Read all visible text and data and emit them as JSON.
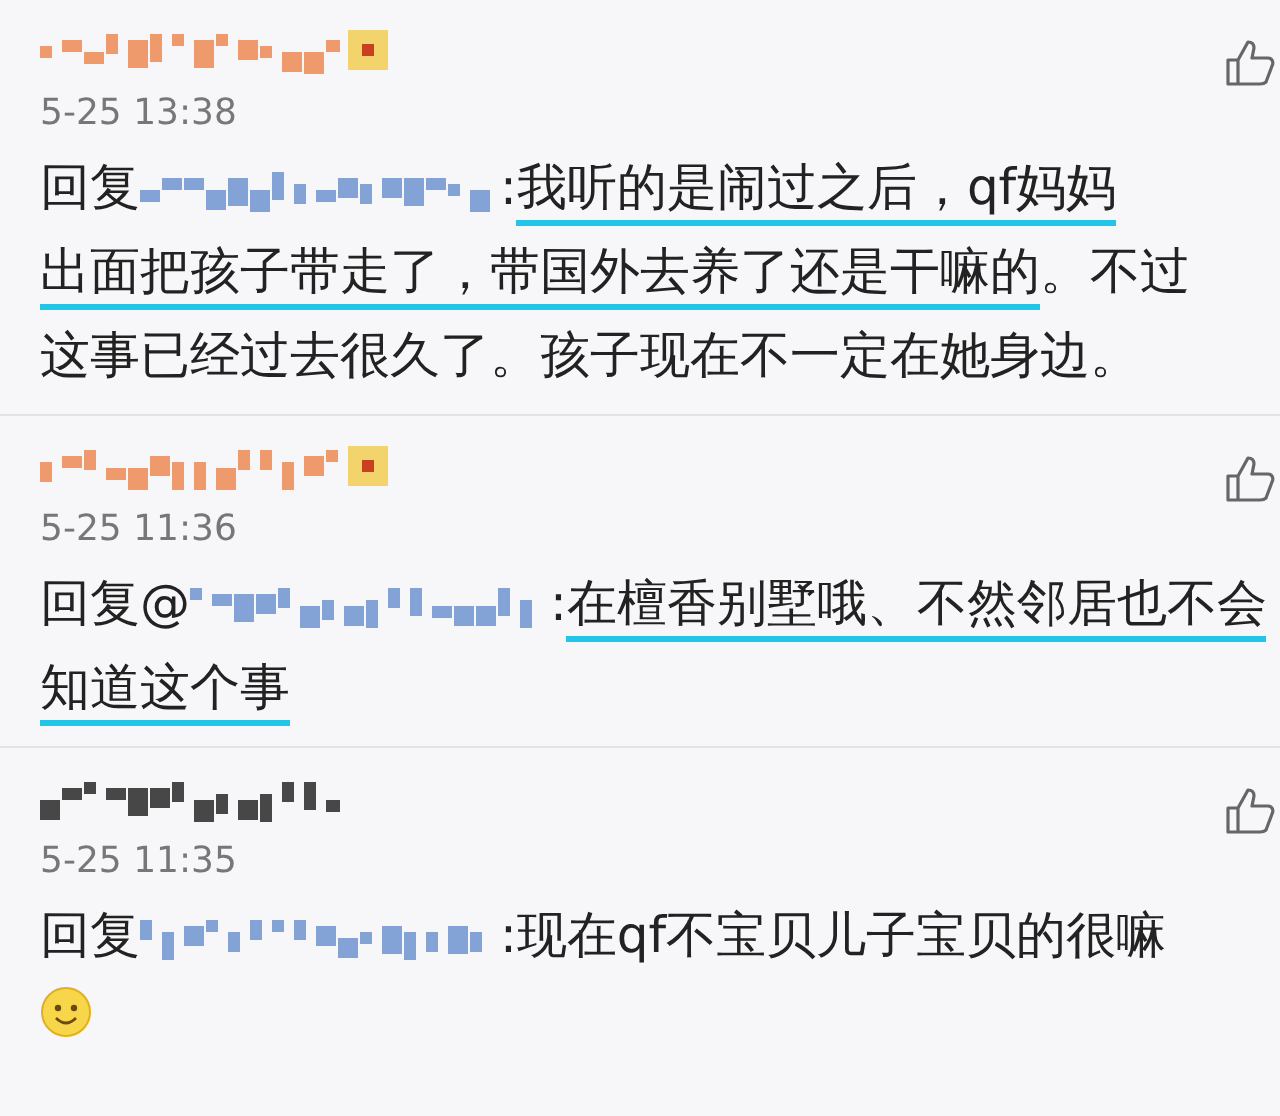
{
  "comments": [
    {
      "vip": true,
      "badge": true,
      "time": "5-25 13:38",
      "reply_prefix": "回复",
      "lines": [
        [
          {
            "text": ":",
            "underlined": false
          },
          {
            "text": "我听的是闹过之后，qf妈妈",
            "underlined": true
          }
        ],
        [
          {
            "text": "出面把孩子带走了，带国外去养了还是干嘛的",
            "underlined": true
          },
          {
            "text": "。不过",
            "underlined": false
          }
        ],
        [
          {
            "text": "这事已经过去很久了。孩子现在不一定在她身边。",
            "underlined": false
          }
        ]
      ],
      "emoji": false
    },
    {
      "vip": true,
      "badge": true,
      "time": "5-25 11:36",
      "reply_prefix": "回复@",
      "lines": [
        [
          {
            "text": ":",
            "underlined": false
          },
          {
            "text": "在檀香别墅哦、不然邻居也不会",
            "underlined": true
          }
        ],
        [
          {
            "text": "知道这个事",
            "underlined": true
          }
        ]
      ],
      "emoji": false
    },
    {
      "vip": false,
      "badge": false,
      "time": "5-25 11:35",
      "reply_prefix": "回复",
      "lines": [
        [
          {
            "text": ":现在qf不宝贝儿子宝贝的很嘛",
            "underlined": false
          }
        ]
      ],
      "emoji": true
    }
  ]
}
